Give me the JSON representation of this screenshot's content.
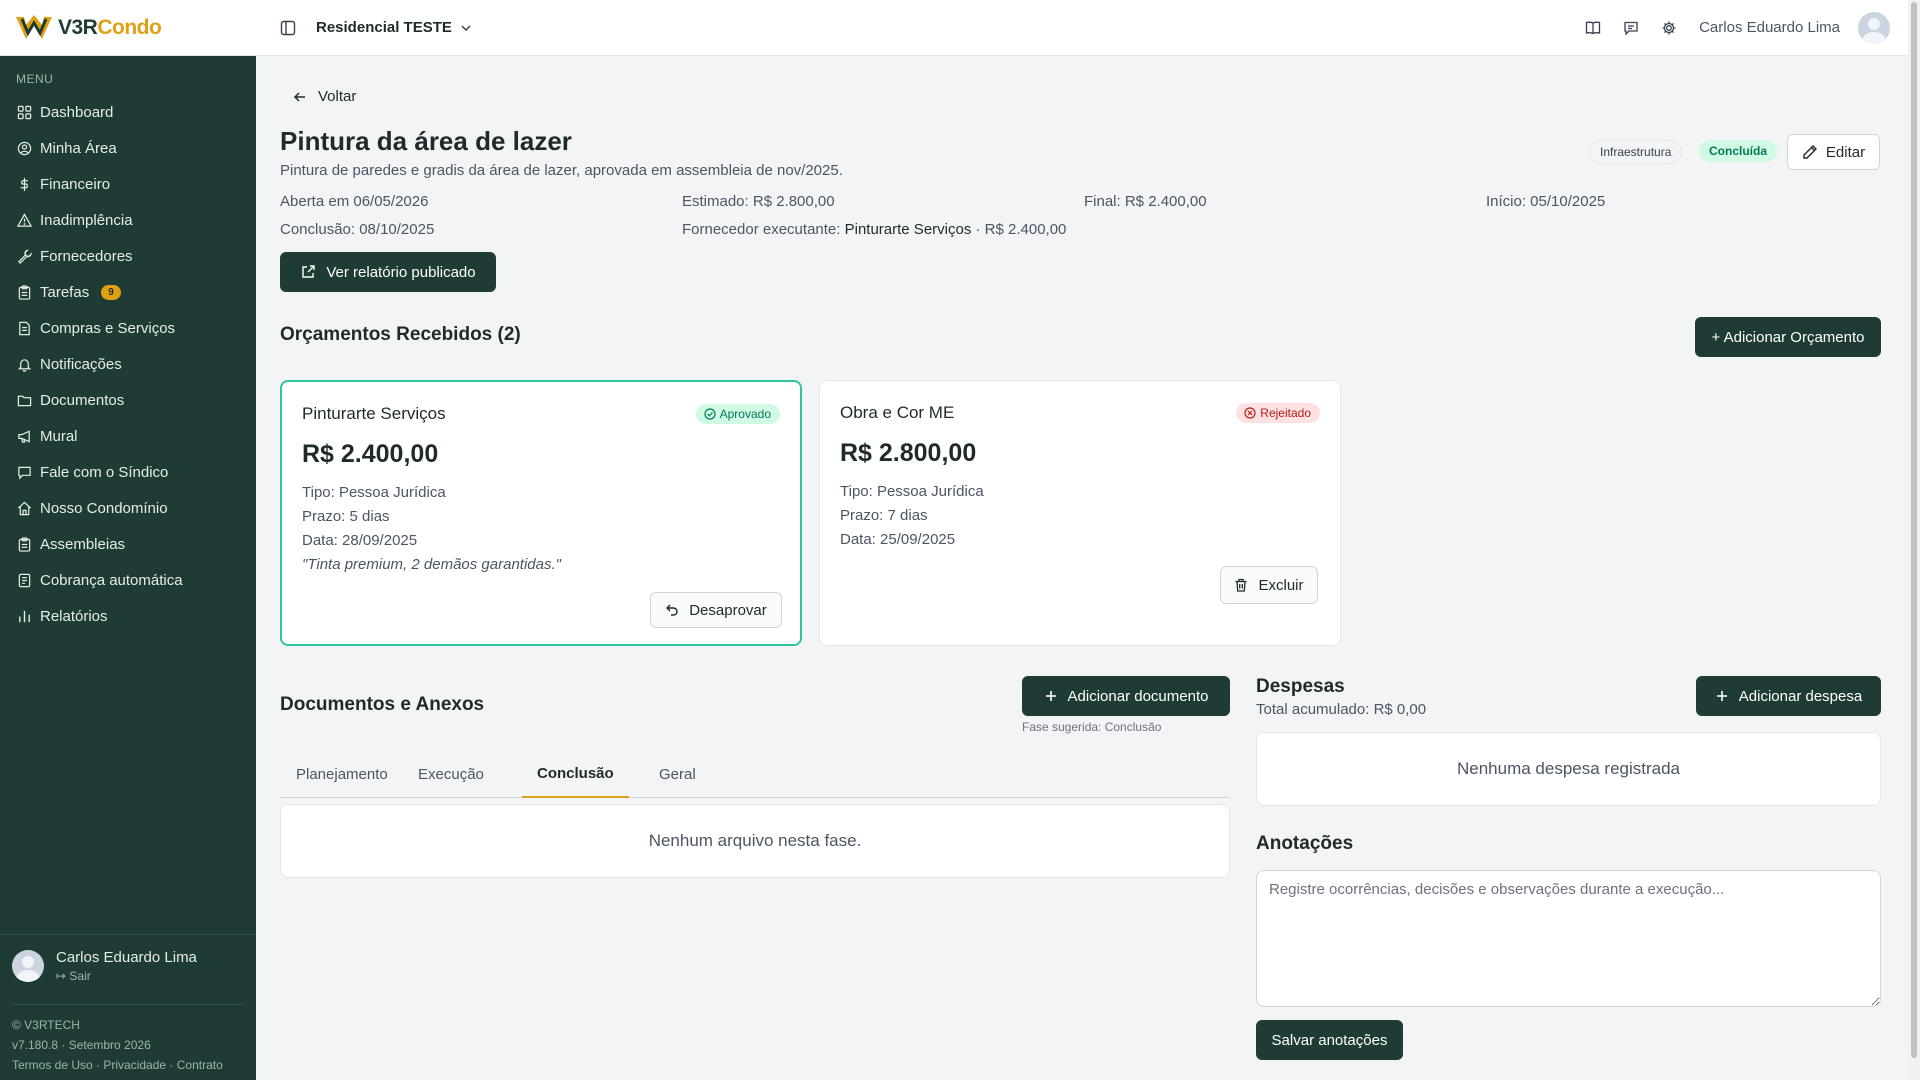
{
  "brand": {
    "part1": "V3R",
    "part2": "Condo"
  },
  "header": {
    "condo": "Residencial TESTE",
    "user_name": "Carlos Eduardo Lima"
  },
  "sidebar": {
    "menu_label": "MENU",
    "items": [
      {
        "label": "Dashboard",
        "icon": "dashboard-icon"
      },
      {
        "label": "Minha Área",
        "icon": "user-circle-icon"
      },
      {
        "label": "Financeiro",
        "icon": "dollar-icon"
      },
      {
        "label": "Inadimplência",
        "icon": "warning-icon"
      },
      {
        "label": "Fornecedores",
        "icon": "wrench-icon"
      },
      {
        "label": "Tarefas",
        "icon": "clipboard-icon",
        "badge": "9"
      },
      {
        "label": "Compras e Serviços",
        "icon": "receipt-icon"
      },
      {
        "label": "Notificações",
        "icon": "bell-icon"
      },
      {
        "label": "Documentos",
        "icon": "folder-icon"
      },
      {
        "label": "Mural",
        "icon": "megaphone-icon"
      },
      {
        "label": "Fale com o Síndico",
        "icon": "chat-icon"
      },
      {
        "label": "Nosso Condomínio",
        "icon": "home-icon"
      },
      {
        "label": "Assembleias",
        "icon": "clipboard-icon"
      },
      {
        "label": "Cobrança automática",
        "icon": "receipt-icon"
      },
      {
        "label": "Relatórios",
        "icon": "bar-chart-icon"
      }
    ],
    "user_name": "Carlos Eduardo Lima",
    "logout": "Sair",
    "footer": {
      "company": "© V3RTECH",
      "version": "v7.180.8 · Setembro 2026",
      "terms": "Termos de Uso",
      "privacy": "Privacidade",
      "contract": "Contrato",
      "separator": " · "
    }
  },
  "page": {
    "back": "Voltar",
    "title": "Pintura da área de lazer",
    "description": "Pintura de paredes e gradis da área de lazer, aprovada em assembleia de nov/2025.",
    "category": "Infraestrutura",
    "status": "Concluída",
    "edit": "Editar",
    "opened": "Aberta em 06/05/2026",
    "estimated": "Estimado: R$ 2.800,00",
    "final": "Final: R$ 2.400,00",
    "start": "Início: 05/10/2025",
    "conclusion": "Conclusão: 08/10/2025",
    "supplier_label": "Fornecedor executante: ",
    "supplier_name": "Pinturarte Serviços",
    "supplier_value": " · R$ 2.400,00",
    "report_button": "Ver relatório publicado"
  },
  "quotes": {
    "title": "Orçamentos Recebidos (2)",
    "add_button": "+ Adicionar Orçamento",
    "items": [
      {
        "name": "Pinturarte Serviços",
        "status": "Aprovado",
        "price": "R$ 2.400,00",
        "type": "Tipo: Pessoa Jurídica",
        "term": "Prazo: 5 dias",
        "date": "Data: 28/09/2025",
        "note": "\"Tinta premium, 2 demãos garantidas.\"",
        "action": "Desaprovar"
      },
      {
        "name": "Obra e Cor ME",
        "status": "Rejeitado",
        "price": "R$ 2.800,00",
        "type": "Tipo: Pessoa Jurídica",
        "term": "Prazo: 7 dias",
        "date": "Data: 25/09/2025",
        "action": "Excluir"
      }
    ]
  },
  "documents": {
    "title": "Documentos e Anexos",
    "add_button": "Adicionar documento",
    "suggested_phase": "Fase sugerida: Conclusão",
    "tabs": [
      "Planejamento",
      "Execução",
      "Conclusão",
      "Geral"
    ],
    "active_tab": "Conclusão",
    "empty": "Nenhum arquivo nesta fase."
  },
  "expenses": {
    "title": "Despesas",
    "total": "Total acumulado: R$ 0,00",
    "add_button": "Adicionar despesa",
    "empty": "Nenhuma despesa registrada"
  },
  "notes": {
    "title": "Anotações",
    "placeholder": "Registre ocorrências, decisões e observações durante a execução...",
    "save": "Salvar anotações"
  },
  "colors": {
    "sidebar": "#1f3b35",
    "accent": "#e0a013",
    "approved": "#2fc4a0",
    "rejected": "#b91c1c"
  }
}
